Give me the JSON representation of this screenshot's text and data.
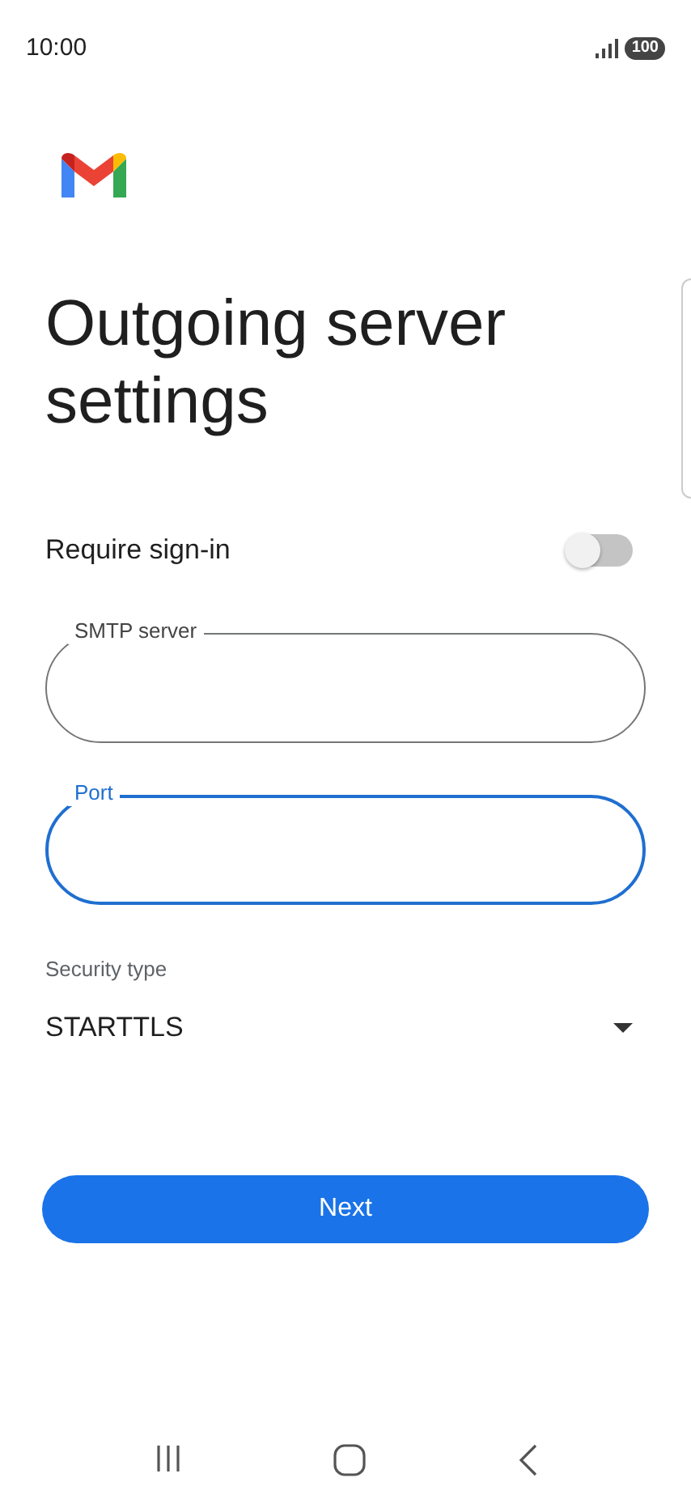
{
  "status_bar": {
    "time": "10:00",
    "battery": "100"
  },
  "title": "Outgoing server settings",
  "require_sign_in": {
    "label": "Require sign-in",
    "on": false
  },
  "fields": [
    {
      "label": "SMTP server",
      "focused": false
    },
    {
      "label": "Port",
      "focused": true
    }
  ],
  "security_type": {
    "label": "Security type",
    "value": "STARTTLS"
  },
  "next_button": "Next"
}
